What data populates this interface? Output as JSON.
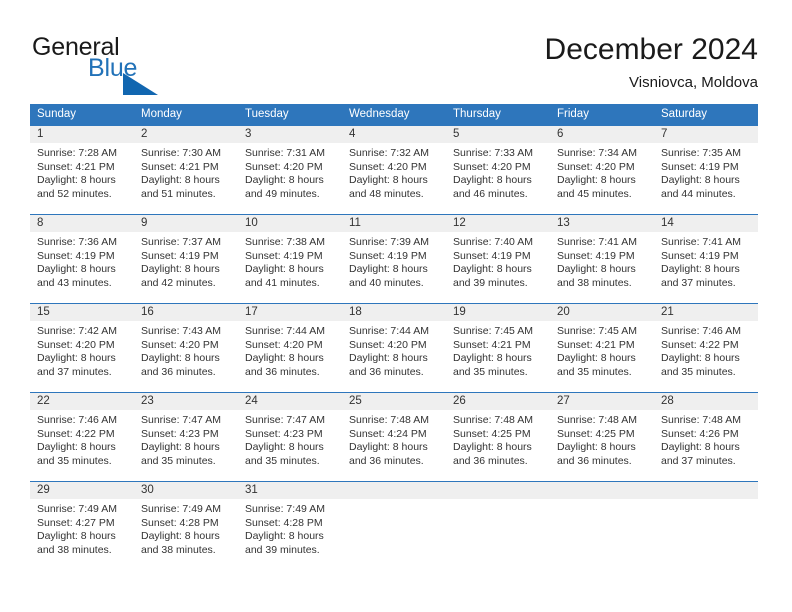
{
  "logo": {
    "word_top": "General",
    "word_bottom": "Blue",
    "triangle_icon": "triangle-icon",
    "blue_hex": "#2272b8",
    "triangle_hex": "#1166b0"
  },
  "header": {
    "month_title": "December 2024",
    "location": "Visniovca, Moldova"
  },
  "theme": {
    "header_blue": "#2e76bc",
    "daynum_bg": "#efefef",
    "text": "#333333"
  },
  "calendar": {
    "day_headers": [
      "Sunday",
      "Monday",
      "Tuesday",
      "Wednesday",
      "Thursday",
      "Friday",
      "Saturday"
    ],
    "weeks": [
      {
        "numbers": [
          "1",
          "2",
          "3",
          "4",
          "5",
          "6",
          "7"
        ],
        "days": [
          {
            "sunrise": "Sunrise: 7:28 AM",
            "sunset": "Sunset: 4:21 PM",
            "daylight1": "Daylight: 8 hours",
            "daylight2": "and 52 minutes."
          },
          {
            "sunrise": "Sunrise: 7:30 AM",
            "sunset": "Sunset: 4:21 PM",
            "daylight1": "Daylight: 8 hours",
            "daylight2": "and 51 minutes."
          },
          {
            "sunrise": "Sunrise: 7:31 AM",
            "sunset": "Sunset: 4:20 PM",
            "daylight1": "Daylight: 8 hours",
            "daylight2": "and 49 minutes."
          },
          {
            "sunrise": "Sunrise: 7:32 AM",
            "sunset": "Sunset: 4:20 PM",
            "daylight1": "Daylight: 8 hours",
            "daylight2": "and 48 minutes."
          },
          {
            "sunrise": "Sunrise: 7:33 AM",
            "sunset": "Sunset: 4:20 PM",
            "daylight1": "Daylight: 8 hours",
            "daylight2": "and 46 minutes."
          },
          {
            "sunrise": "Sunrise: 7:34 AM",
            "sunset": "Sunset: 4:20 PM",
            "daylight1": "Daylight: 8 hours",
            "daylight2": "and 45 minutes."
          },
          {
            "sunrise": "Sunrise: 7:35 AM",
            "sunset": "Sunset: 4:19 PM",
            "daylight1": "Daylight: 8 hours",
            "daylight2": "and 44 minutes."
          }
        ]
      },
      {
        "numbers": [
          "8",
          "9",
          "10",
          "11",
          "12",
          "13",
          "14"
        ],
        "days": [
          {
            "sunrise": "Sunrise: 7:36 AM",
            "sunset": "Sunset: 4:19 PM",
            "daylight1": "Daylight: 8 hours",
            "daylight2": "and 43 minutes."
          },
          {
            "sunrise": "Sunrise: 7:37 AM",
            "sunset": "Sunset: 4:19 PM",
            "daylight1": "Daylight: 8 hours",
            "daylight2": "and 42 minutes."
          },
          {
            "sunrise": "Sunrise: 7:38 AM",
            "sunset": "Sunset: 4:19 PM",
            "daylight1": "Daylight: 8 hours",
            "daylight2": "and 41 minutes."
          },
          {
            "sunrise": "Sunrise: 7:39 AM",
            "sunset": "Sunset: 4:19 PM",
            "daylight1": "Daylight: 8 hours",
            "daylight2": "and 40 minutes."
          },
          {
            "sunrise": "Sunrise: 7:40 AM",
            "sunset": "Sunset: 4:19 PM",
            "daylight1": "Daylight: 8 hours",
            "daylight2": "and 39 minutes."
          },
          {
            "sunrise": "Sunrise: 7:41 AM",
            "sunset": "Sunset: 4:19 PM",
            "daylight1": "Daylight: 8 hours",
            "daylight2": "and 38 minutes."
          },
          {
            "sunrise": "Sunrise: 7:41 AM",
            "sunset": "Sunset: 4:19 PM",
            "daylight1": "Daylight: 8 hours",
            "daylight2": "and 37 minutes."
          }
        ]
      },
      {
        "numbers": [
          "15",
          "16",
          "17",
          "18",
          "19",
          "20",
          "21"
        ],
        "days": [
          {
            "sunrise": "Sunrise: 7:42 AM",
            "sunset": "Sunset: 4:20 PM",
            "daylight1": "Daylight: 8 hours",
            "daylight2": "and 37 minutes."
          },
          {
            "sunrise": "Sunrise: 7:43 AM",
            "sunset": "Sunset: 4:20 PM",
            "daylight1": "Daylight: 8 hours",
            "daylight2": "and 36 minutes."
          },
          {
            "sunrise": "Sunrise: 7:44 AM",
            "sunset": "Sunset: 4:20 PM",
            "daylight1": "Daylight: 8 hours",
            "daylight2": "and 36 minutes."
          },
          {
            "sunrise": "Sunrise: 7:44 AM",
            "sunset": "Sunset: 4:20 PM",
            "daylight1": "Daylight: 8 hours",
            "daylight2": "and 36 minutes."
          },
          {
            "sunrise": "Sunrise: 7:45 AM",
            "sunset": "Sunset: 4:21 PM",
            "daylight1": "Daylight: 8 hours",
            "daylight2": "and 35 minutes."
          },
          {
            "sunrise": "Sunrise: 7:45 AM",
            "sunset": "Sunset: 4:21 PM",
            "daylight1": "Daylight: 8 hours",
            "daylight2": "and 35 minutes."
          },
          {
            "sunrise": "Sunrise: 7:46 AM",
            "sunset": "Sunset: 4:22 PM",
            "daylight1": "Daylight: 8 hours",
            "daylight2": "and 35 minutes."
          }
        ]
      },
      {
        "numbers": [
          "22",
          "23",
          "24",
          "25",
          "26",
          "27",
          "28"
        ],
        "days": [
          {
            "sunrise": "Sunrise: 7:46 AM",
            "sunset": "Sunset: 4:22 PM",
            "daylight1": "Daylight: 8 hours",
            "daylight2": "and 35 minutes."
          },
          {
            "sunrise": "Sunrise: 7:47 AM",
            "sunset": "Sunset: 4:23 PM",
            "daylight1": "Daylight: 8 hours",
            "daylight2": "and 35 minutes."
          },
          {
            "sunrise": "Sunrise: 7:47 AM",
            "sunset": "Sunset: 4:23 PM",
            "daylight1": "Daylight: 8 hours",
            "daylight2": "and 35 minutes."
          },
          {
            "sunrise": "Sunrise: 7:48 AM",
            "sunset": "Sunset: 4:24 PM",
            "daylight1": "Daylight: 8 hours",
            "daylight2": "and 36 minutes."
          },
          {
            "sunrise": "Sunrise: 7:48 AM",
            "sunset": "Sunset: 4:25 PM",
            "daylight1": "Daylight: 8 hours",
            "daylight2": "and 36 minutes."
          },
          {
            "sunrise": "Sunrise: 7:48 AM",
            "sunset": "Sunset: 4:25 PM",
            "daylight1": "Daylight: 8 hours",
            "daylight2": "and 36 minutes."
          },
          {
            "sunrise": "Sunrise: 7:48 AM",
            "sunset": "Sunset: 4:26 PM",
            "daylight1": "Daylight: 8 hours",
            "daylight2": "and 37 minutes."
          }
        ]
      },
      {
        "numbers": [
          "29",
          "30",
          "31",
          "",
          "",
          "",
          ""
        ],
        "days": [
          {
            "sunrise": "Sunrise: 7:49 AM",
            "sunset": "Sunset: 4:27 PM",
            "daylight1": "Daylight: 8 hours",
            "daylight2": "and 38 minutes."
          },
          {
            "sunrise": "Sunrise: 7:49 AM",
            "sunset": "Sunset: 4:28 PM",
            "daylight1": "Daylight: 8 hours",
            "daylight2": "and 38 minutes."
          },
          {
            "sunrise": "Sunrise: 7:49 AM",
            "sunset": "Sunset: 4:28 PM",
            "daylight1": "Daylight: 8 hours",
            "daylight2": "and 39 minutes."
          },
          {
            "sunrise": "",
            "sunset": "",
            "daylight1": "",
            "daylight2": ""
          },
          {
            "sunrise": "",
            "sunset": "",
            "daylight1": "",
            "daylight2": ""
          },
          {
            "sunrise": "",
            "sunset": "",
            "daylight1": "",
            "daylight2": ""
          },
          {
            "sunrise": "",
            "sunset": "",
            "daylight1": "",
            "daylight2": ""
          }
        ]
      }
    ]
  }
}
